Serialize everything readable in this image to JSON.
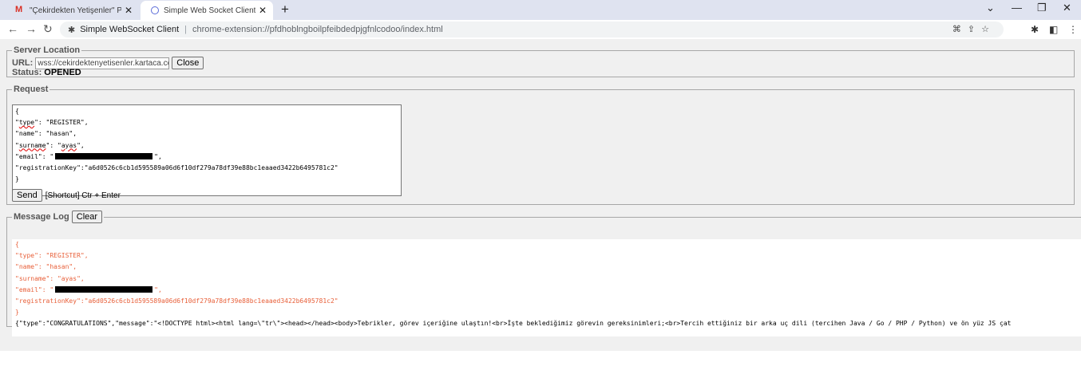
{
  "browser": {
    "tabs": [
      {
        "title": "\"Çekirdekten Yetişenler\" Program",
        "icon": "gmail-icon",
        "active": false
      },
      {
        "title": "Simple Web Socket Client",
        "icon": "globe-icon",
        "active": true
      }
    ],
    "new_tab_label": "+",
    "window_controls": {
      "chevron": "⌄",
      "minimize": "—",
      "restore": "❐",
      "close": "✕"
    },
    "address": {
      "site_name": "Simple WebSocket Client",
      "url": "chrome-extension://pfdhoblngboilpfeibdedpjgfnlcodoo/index.html"
    }
  },
  "server": {
    "legend": "Server Location",
    "url_label": "URL:",
    "url_value": "wss://cekirdektenyetisenler.kartaca.co",
    "close_label": "Close",
    "status_label": "Status:",
    "status_value": "OPENED"
  },
  "request": {
    "legend": "Request",
    "lines": {
      "open": "{",
      "type": "\"type\": \"REGISTER\",",
      "name": "\"name\": \"hasan\",",
      "surname": "\"surname\": \"ayas\",",
      "email_prefix": "\"email\": \"",
      "email_suffix": "\",",
      "key": "\"registrationKey\":\"a6d0526c6cb1d595589a06d6f10df279a78df39e88bc1eaaed3422b6495781c2\"",
      "close": "}"
    },
    "send_label": "Send",
    "shortcut_hint": "[Shortcut] Ctr + Enter"
  },
  "message_log": {
    "legend": "Message Log",
    "clear_label": "Clear",
    "sent": {
      "open": "{",
      "type": "\"type\": \"REGISTER\",",
      "name": "\"name\": \"hasan\",",
      "surname": "\"surname\": \"ayas\",",
      "email_prefix": "\"email\": \"",
      "email_suffix": "\",",
      "key": "\"registrationKey\":\"a6d0526c6cb1d595589a06d6f10df279a78df39e88bc1eaaed3422b6495781c2\"",
      "close": "}"
    },
    "received": "{\"type\":\"CONGRATULATIONS\",\"message\":\"<!DOCTYPE html><html lang=\\\"tr\\\"><head></head><body>Tebrikler, görev içeriğine ulaştın!<br>İşte beklediğimiz görevin gereksinimleri;<br>Tercih ettiğiniz bir arka uç dili (tercihen Java / Go / PHP / Python) ve ön yüz JS çat"
  },
  "colors": {
    "sent_text": "#e8603a",
    "tab_strip": "#dfe3f0",
    "content_bg": "#f0f0f0"
  }
}
